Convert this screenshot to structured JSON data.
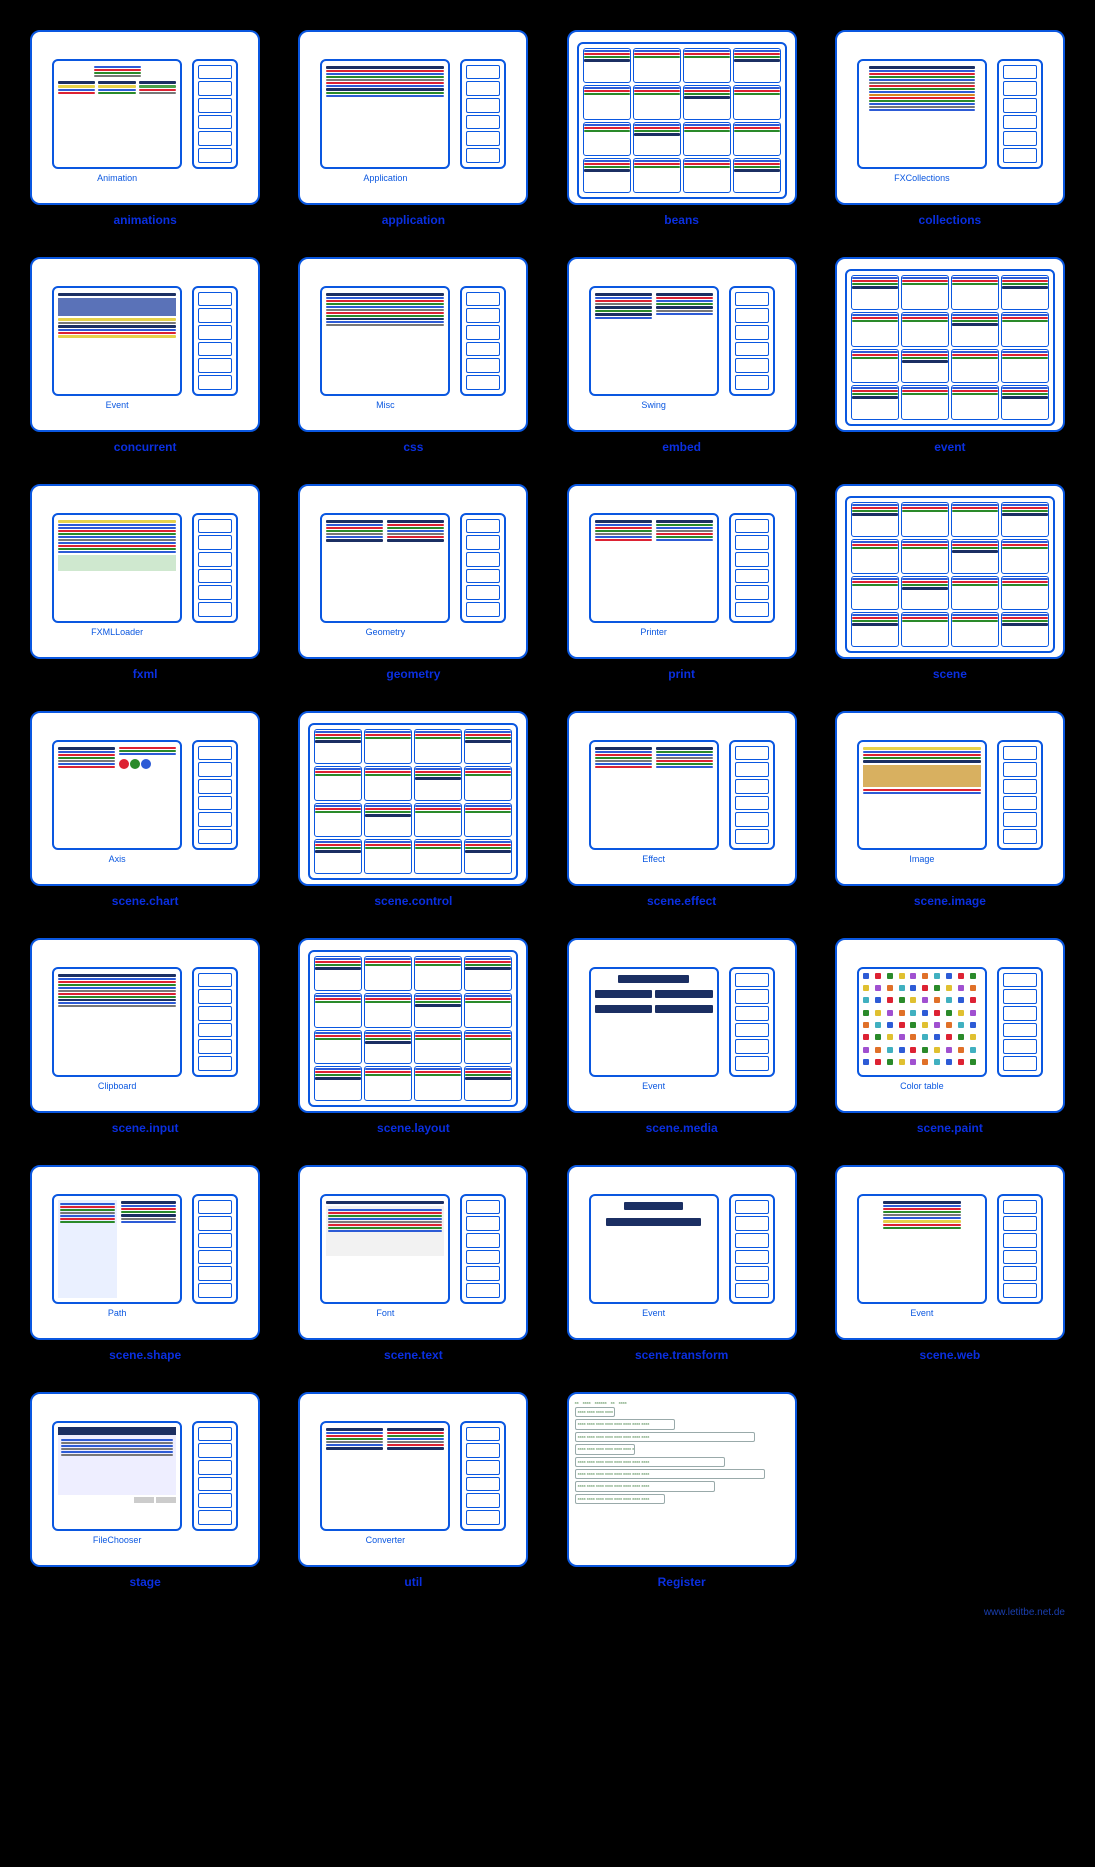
{
  "footer": "www.letitbe.net.de",
  "items": [
    {
      "category": "animations",
      "caption": "Animation",
      "layout": "std",
      "pattern": "tree"
    },
    {
      "category": "application",
      "caption": "Application",
      "layout": "std",
      "pattern": "box"
    },
    {
      "category": "beans",
      "caption": "",
      "layout": "mosaic",
      "pattern": "mosaic"
    },
    {
      "category": "collections",
      "caption": "FXCollections",
      "layout": "std",
      "pattern": "lines"
    },
    {
      "category": "concurrent",
      "caption": "Event",
      "layout": "std",
      "pattern": "panel"
    },
    {
      "category": "css",
      "caption": "Misc",
      "layout": "std",
      "pattern": "text"
    },
    {
      "category": "embed",
      "caption": "Swing",
      "layout": "std",
      "pattern": "dualpanel"
    },
    {
      "category": "event",
      "caption": "",
      "layout": "mosaic",
      "pattern": "mosaic2"
    },
    {
      "category": "fxml",
      "caption": "FXMLLoader",
      "layout": "std",
      "pattern": "striped"
    },
    {
      "category": "geometry",
      "caption": "Geometry",
      "layout": "std",
      "pattern": "cols"
    },
    {
      "category": "print",
      "caption": "Printer",
      "layout": "std",
      "pattern": "twocol"
    },
    {
      "category": "scene",
      "caption": "",
      "layout": "mosaic",
      "pattern": "mosaic3"
    },
    {
      "category": "scene.chart",
      "caption": "Axis",
      "layout": "std",
      "pattern": "chartish"
    },
    {
      "category": "scene.control",
      "caption": "",
      "layout": "mosaic",
      "pattern": "mosaic"
    },
    {
      "category": "scene.effect",
      "caption": "Effect",
      "layout": "std",
      "pattern": "twocol"
    },
    {
      "category": "scene.image",
      "caption": "Image",
      "layout": "std",
      "pattern": "image"
    },
    {
      "category": "scene.input",
      "caption": "Clipboard",
      "layout": "std",
      "pattern": "text"
    },
    {
      "category": "scene.layout",
      "caption": "",
      "layout": "mosaic",
      "pattern": "mosaic4"
    },
    {
      "category": "scene.media",
      "caption": "Event",
      "layout": "std",
      "pattern": "boxes3"
    },
    {
      "category": "scene.paint",
      "caption": "Color table",
      "layout": "std",
      "pattern": "palette"
    },
    {
      "category": "scene.shape",
      "caption": "Path",
      "layout": "std",
      "pattern": "twocol2"
    },
    {
      "category": "scene.text",
      "caption": "Font",
      "layout": "std",
      "pattern": "font"
    },
    {
      "category": "scene.transform",
      "caption": "Event",
      "layout": "std",
      "pattern": "hier"
    },
    {
      "category": "scene.web",
      "caption": "Event",
      "layout": "std",
      "pattern": "center"
    },
    {
      "category": "stage",
      "caption": "FileChooser",
      "layout": "std",
      "pattern": "dialog"
    },
    {
      "category": "util",
      "caption": "Converter",
      "layout": "std",
      "pattern": "cols"
    },
    {
      "category": "Register",
      "caption": "",
      "layout": "register",
      "pattern": "register"
    }
  ]
}
